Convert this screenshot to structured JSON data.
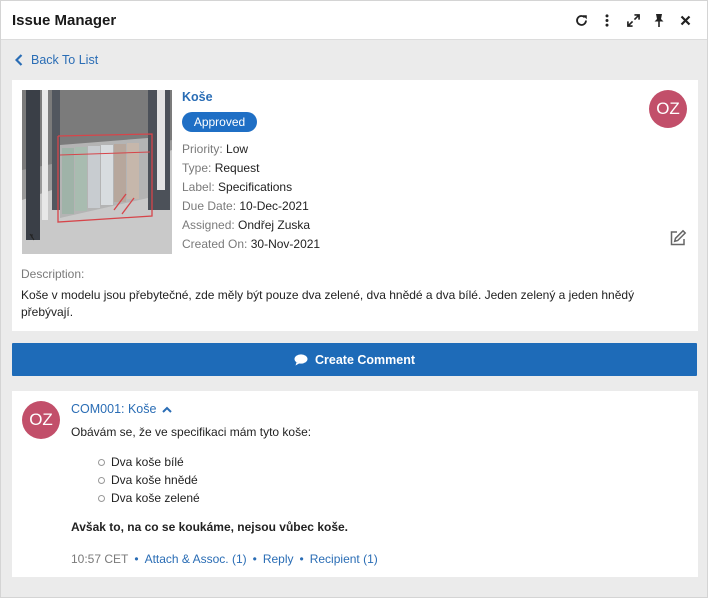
{
  "window": {
    "title": "Issue Manager"
  },
  "toolbar": {
    "icons": [
      "refresh-icon",
      "more-vertical-icon",
      "expand-icon",
      "pin-icon",
      "close-icon"
    ]
  },
  "nav": {
    "back_label": "Back To List"
  },
  "issue": {
    "title": "Koše",
    "status": "Approved",
    "status_color": "#1f6fc5",
    "avatar_initials": "OZ",
    "avatar_color": "#c24f6a",
    "fields": [
      {
        "label": "Priority:",
        "value": "Low"
      },
      {
        "label": "Type:",
        "value": "Request"
      },
      {
        "label": "Label:",
        "value": "Specifications"
      },
      {
        "label": "Due Date:",
        "value": "10-Dec-2021"
      },
      {
        "label": "Assigned:",
        "value": "Ondřej Zuska"
      },
      {
        "label": "Created On:",
        "value": "30-Nov-2021"
      }
    ],
    "description_label": "Description:",
    "description": "Koše v modelu jsou přebytečné, zde měly být pouze dva zelené, dva hnědé a dva bílé. Jeden zelený a jeden hnědý přebývají."
  },
  "actions": {
    "create_comment_label": "Create Comment"
  },
  "comment": {
    "avatar_initials": "OZ",
    "heading": "COM001: Koše",
    "intro": "Obávám se, že ve specifikaci mám tyto koše:",
    "items": [
      "Dva koše bílé",
      "Dva koše hnědé",
      "Dva koše zelené"
    ],
    "conclusion": "Avšak to, na co se koukáme, nejsou vůbec koše.",
    "time": "10:57 CET",
    "attach_label": "Attach & Assoc. (1)",
    "reply_label": "Reply",
    "recipient_label": "Recipient (1)"
  },
  "colors": {
    "accent": "#2a6db5",
    "button": "#1e6bb8",
    "background": "#ebebeb"
  }
}
